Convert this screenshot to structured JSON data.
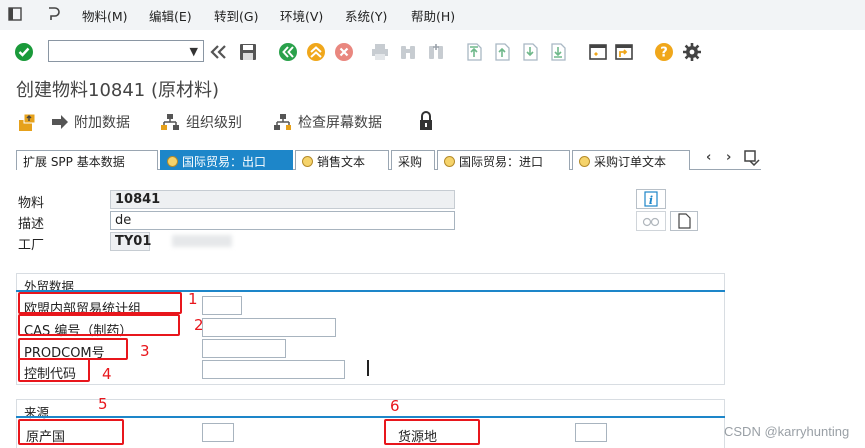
{
  "menu": {
    "items": [
      "物料(M)",
      "编辑(E)",
      "转到(G)",
      "环境(V)",
      "系统(Y)",
      "帮助(H)"
    ]
  },
  "toolbar": {
    "icons": [
      "enter-icon",
      "back-icon",
      "save-icon",
      "back-nav-icon",
      "exit-icon",
      "cancel-icon",
      "print-icon",
      "find-icon",
      "find-next-icon",
      "first-page-icon",
      "prev-page-icon",
      "next-page-icon",
      "last-page-icon",
      "new-session-icon",
      "shortcut-icon",
      "help-icon",
      "settings-icon"
    ]
  },
  "title": "创建物料10841 (原材料)",
  "app_toolbar": {
    "additional_data": "附加数据",
    "org_levels": "组织级别",
    "check_screen": "检查屏幕数据"
  },
  "tabs": [
    {
      "label": "扩展 SPP 基本数据",
      "icon": false,
      "active": false
    },
    {
      "label": "国际贸易：出口",
      "icon": true,
      "active": true
    },
    {
      "label": "销售文本",
      "icon": true,
      "active": false
    },
    {
      "label": "采购",
      "icon": false,
      "active": false
    },
    {
      "label": "国际贸易：进口",
      "icon": true,
      "active": false
    },
    {
      "label": "采购订单文本",
      "icon": true,
      "active": false
    }
  ],
  "header": {
    "material_label": "物料",
    "material_value": "10841",
    "desc_label": "描述",
    "desc_value": "de",
    "plant_label": "工厂",
    "plant_value": "TY01"
  },
  "foreign_trade": {
    "title": "外贸数据",
    "eu_stats_label": "欧盟内部贸易统计组",
    "cas_label": "CAS 编号（制药）",
    "prodcom_label": "PRODCOM号",
    "control_label": "控制代码"
  },
  "origin": {
    "title": "来源",
    "country_label": "原产国",
    "region_label": "货源地"
  },
  "annotations": [
    "1",
    "2",
    "3",
    "4",
    "5",
    "6"
  ],
  "watermark": "CSDN @karryhunting",
  "colors": {
    "accent": "#1d86c9",
    "annotation": "#e8161c",
    "enter": "#1a9a3a",
    "nav": "#2aa14b",
    "exit": "#f0a71b",
    "cancel": "#e0453c"
  }
}
